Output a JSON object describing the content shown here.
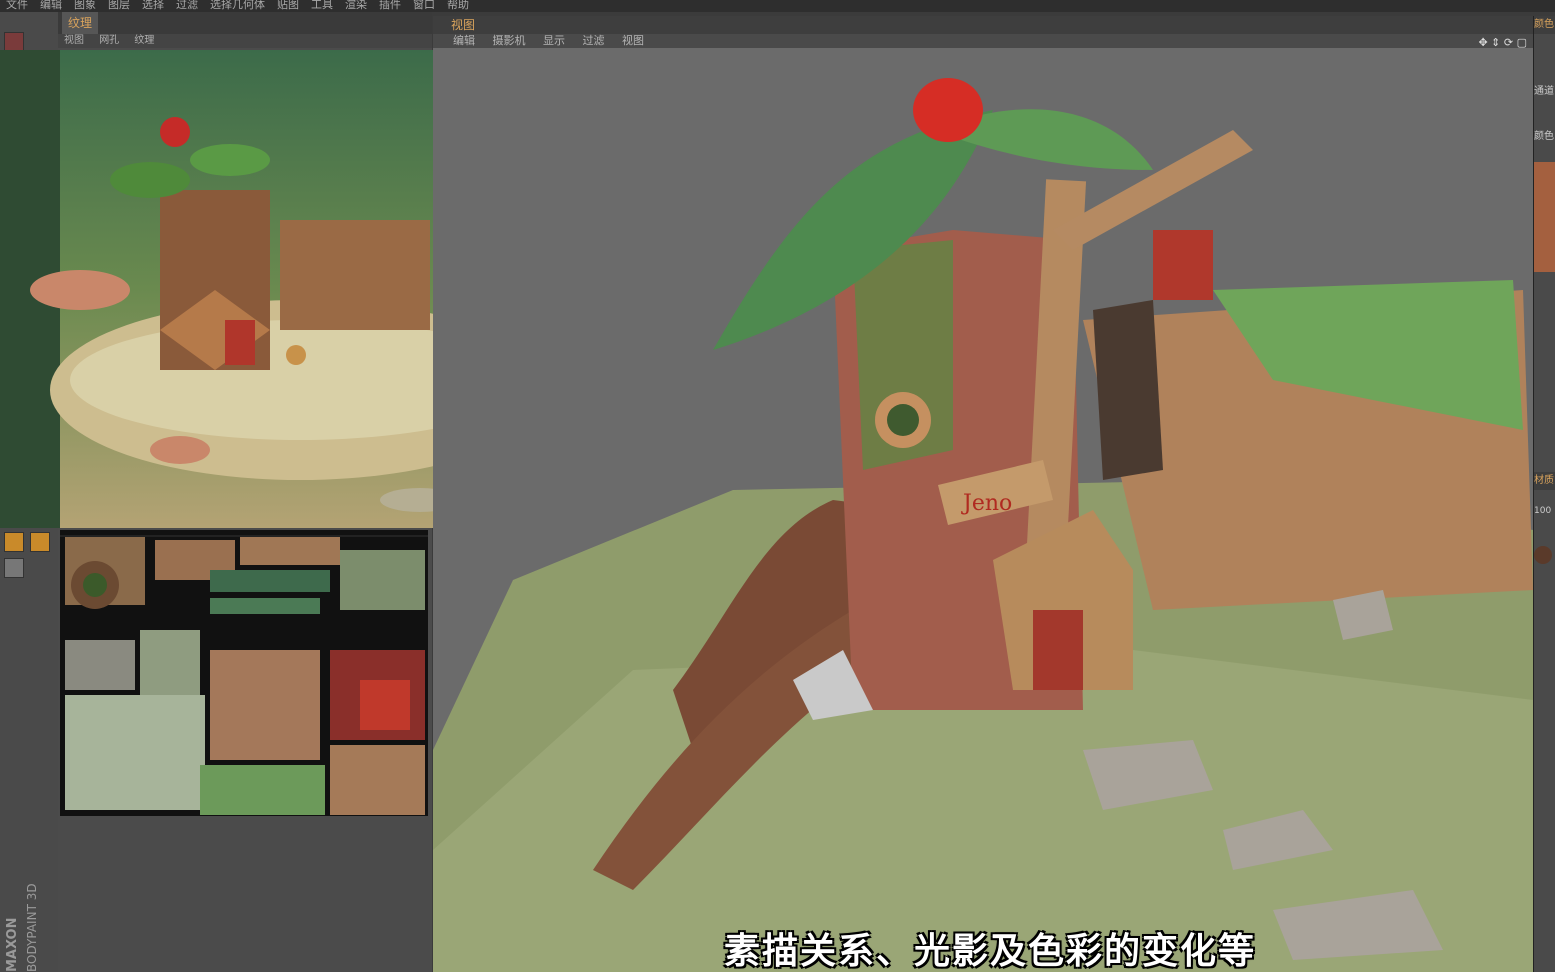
{
  "menubar": [
    "文件",
    "编辑",
    "图象",
    "图层",
    "选择",
    "过滤",
    "选择几何体",
    "贴图",
    "工具",
    "渲染",
    "插件",
    "窗口",
    "帮助"
  ],
  "texture_panel": {
    "tab": "纹理",
    "menu": [
      "视图",
      "网孔",
      "纹理"
    ]
  },
  "viewport": {
    "tab": "视图",
    "menu": [
      "编辑",
      "摄影机",
      "显示",
      "过滤",
      "视图"
    ],
    "sign_text": "Jeno"
  },
  "right_panel": {
    "labels": [
      "颜色",
      "通道",
      "颜色",
      "材质"
    ],
    "value": "100"
  },
  "logo": {
    "line1": "MAXON",
    "line2": "BODYPAINT 3D"
  },
  "subtitle": "素描关系、光影及色彩的变化等",
  "colors": {
    "accent": "#d9a35c",
    "bg": "#3b3b3b"
  }
}
